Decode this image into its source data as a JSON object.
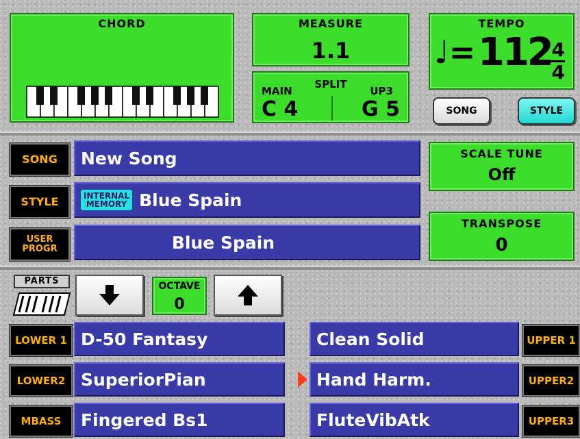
{
  "chord": {
    "title": "CHORD"
  },
  "measure": {
    "title": "MEASURE",
    "value": "1.1"
  },
  "split": {
    "title": "SPLIT",
    "main_label": "MAIN",
    "up_label": "UP3",
    "main_value": "C 4",
    "up_value": "G 5"
  },
  "tempo": {
    "title": "TEMPO",
    "note_symbol": "♩=",
    "value": "112",
    "sig_top": "4",
    "sig_bottom": "4"
  },
  "mode_buttons": {
    "song": "SONG",
    "style": "STYLE",
    "active": "STYLE"
  },
  "song_row": {
    "tag": "SONG",
    "value": "New Song"
  },
  "style_row": {
    "tag": "STYLE",
    "badge_line1": "INTERNAL",
    "badge_line2": "MEMORY",
    "value": "Blue Spain"
  },
  "userprog_row": {
    "tag_line1": "USER",
    "tag_line2": "PROGR",
    "value": "Blue Spain"
  },
  "scale_tune": {
    "title": "SCALE TUNE",
    "value": "Off"
  },
  "transpose": {
    "title": "TRANSPOSE",
    "value": "0"
  },
  "parts": {
    "label": "PARTS"
  },
  "octave": {
    "title": "OCTAVE",
    "value": "0"
  },
  "lower_parts": [
    {
      "tag": "LOWER 1",
      "value": "D-50 Fantasy"
    },
    {
      "tag": "LOWER2",
      "value": "SuperiorPian"
    },
    {
      "tag": "MBASS",
      "value": "Fingered Bs1"
    }
  ],
  "upper_parts": [
    {
      "tag": "UPPER 1",
      "value": "Clean Solid"
    },
    {
      "tag": "UPPER2",
      "value": "Hand Harm."
    },
    {
      "tag": "UPPER3",
      "value": "FluteVibAtk"
    }
  ],
  "selected_upper": "UPPER2",
  "colors": {
    "panel_green": "#3bdc2a",
    "bar_blue": "#3a3aa8",
    "tag_text": "#ffb000",
    "active_button": "#22d6d0",
    "arrow_red": "#ff3b1a"
  }
}
